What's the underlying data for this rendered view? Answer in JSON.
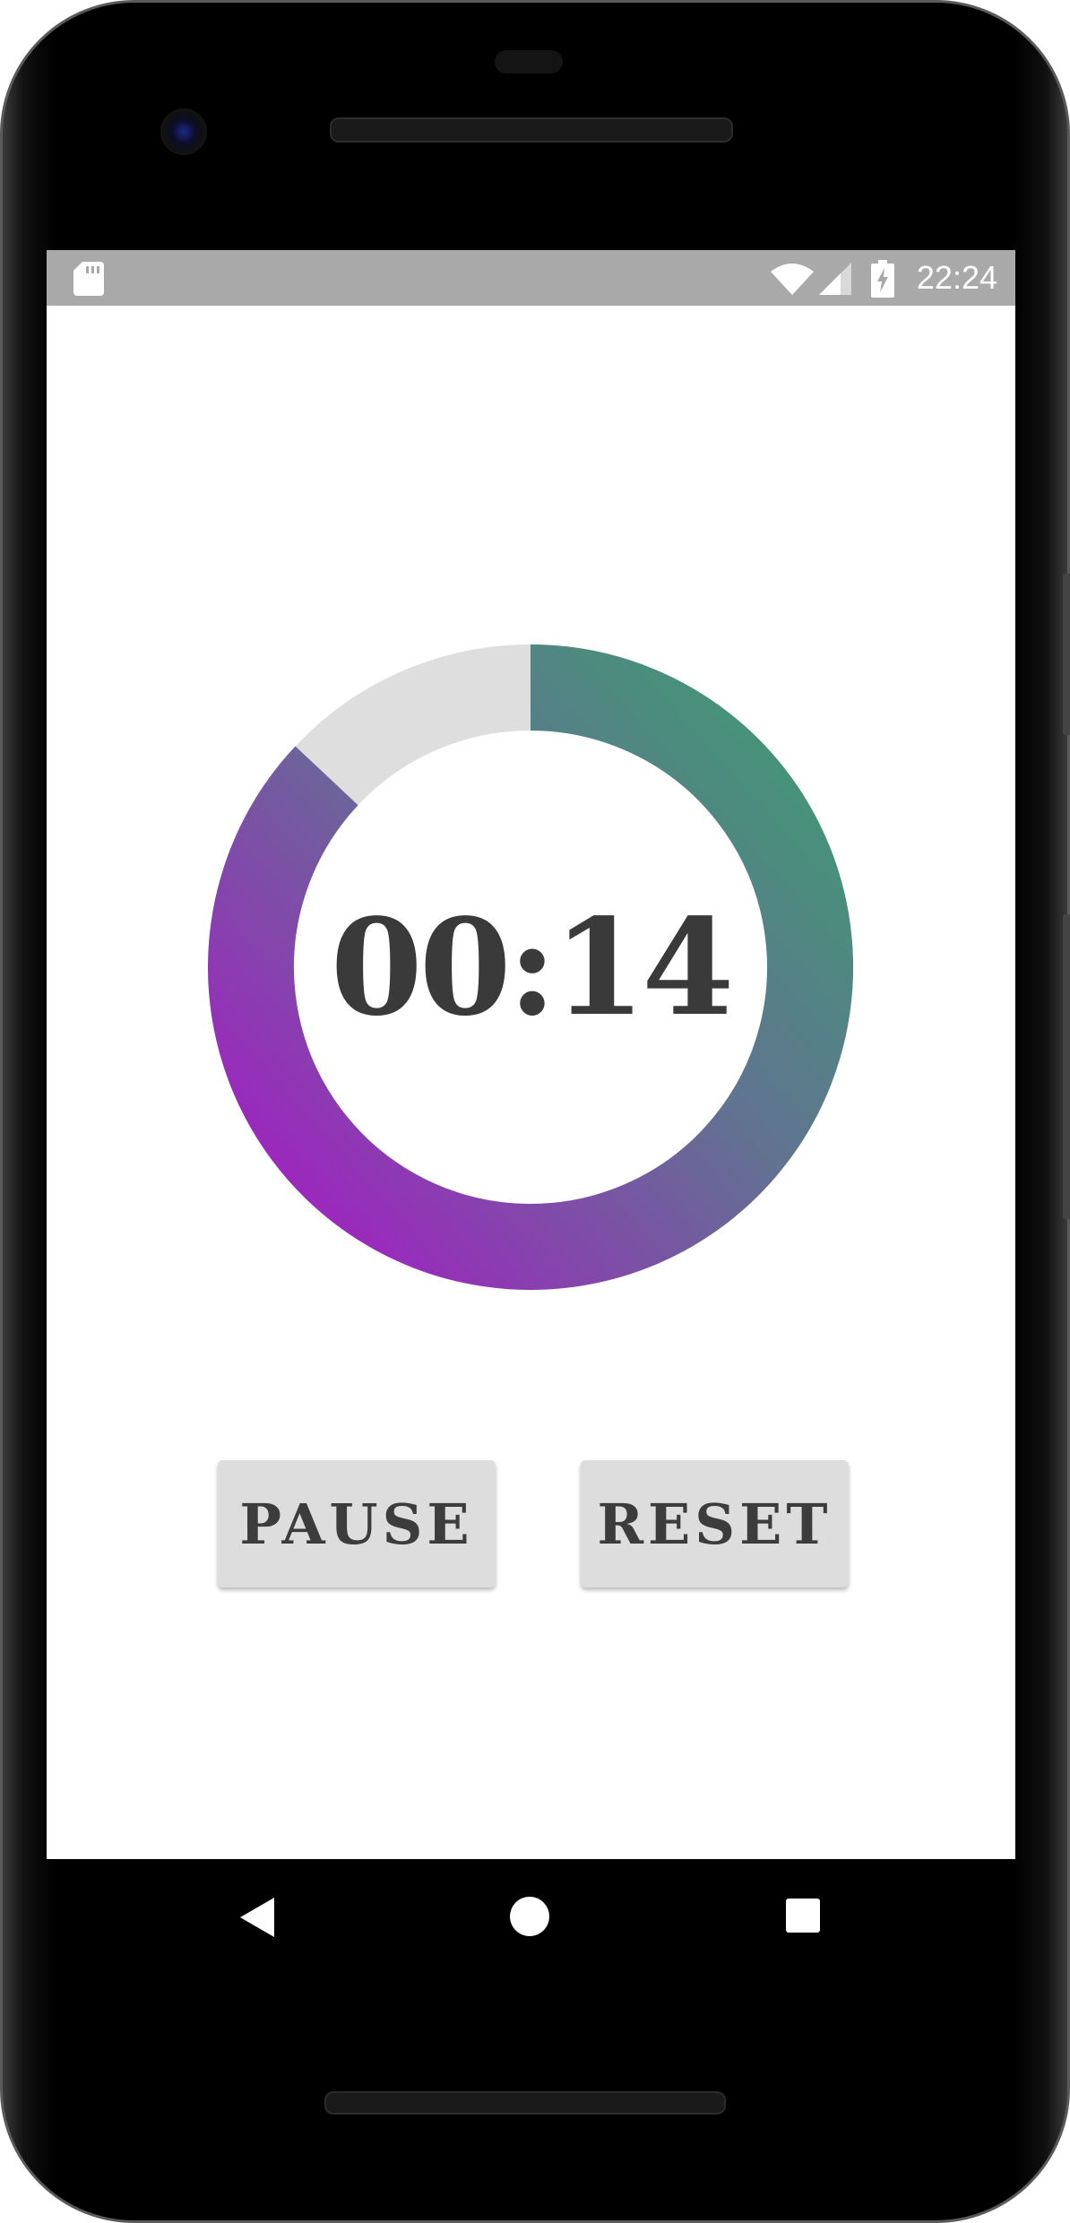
{
  "status_bar": {
    "time": "22:24",
    "icons": [
      "sd-card-icon",
      "wifi-icon",
      "cell-signal-icon",
      "battery-charging-icon"
    ],
    "background": "#a9a9a9"
  },
  "timer": {
    "display": "00:14",
    "progress_fraction": 0.87,
    "ring_gradient_start": "#3f9b72",
    "ring_gradient_end": "#a021c1",
    "ring_track_color": "#dedede"
  },
  "controls": {
    "pause_label": "PAUSE",
    "reset_label": "RESET"
  },
  "nav_bar": {
    "icons": [
      "back-icon",
      "home-icon",
      "recents-icon"
    ]
  }
}
